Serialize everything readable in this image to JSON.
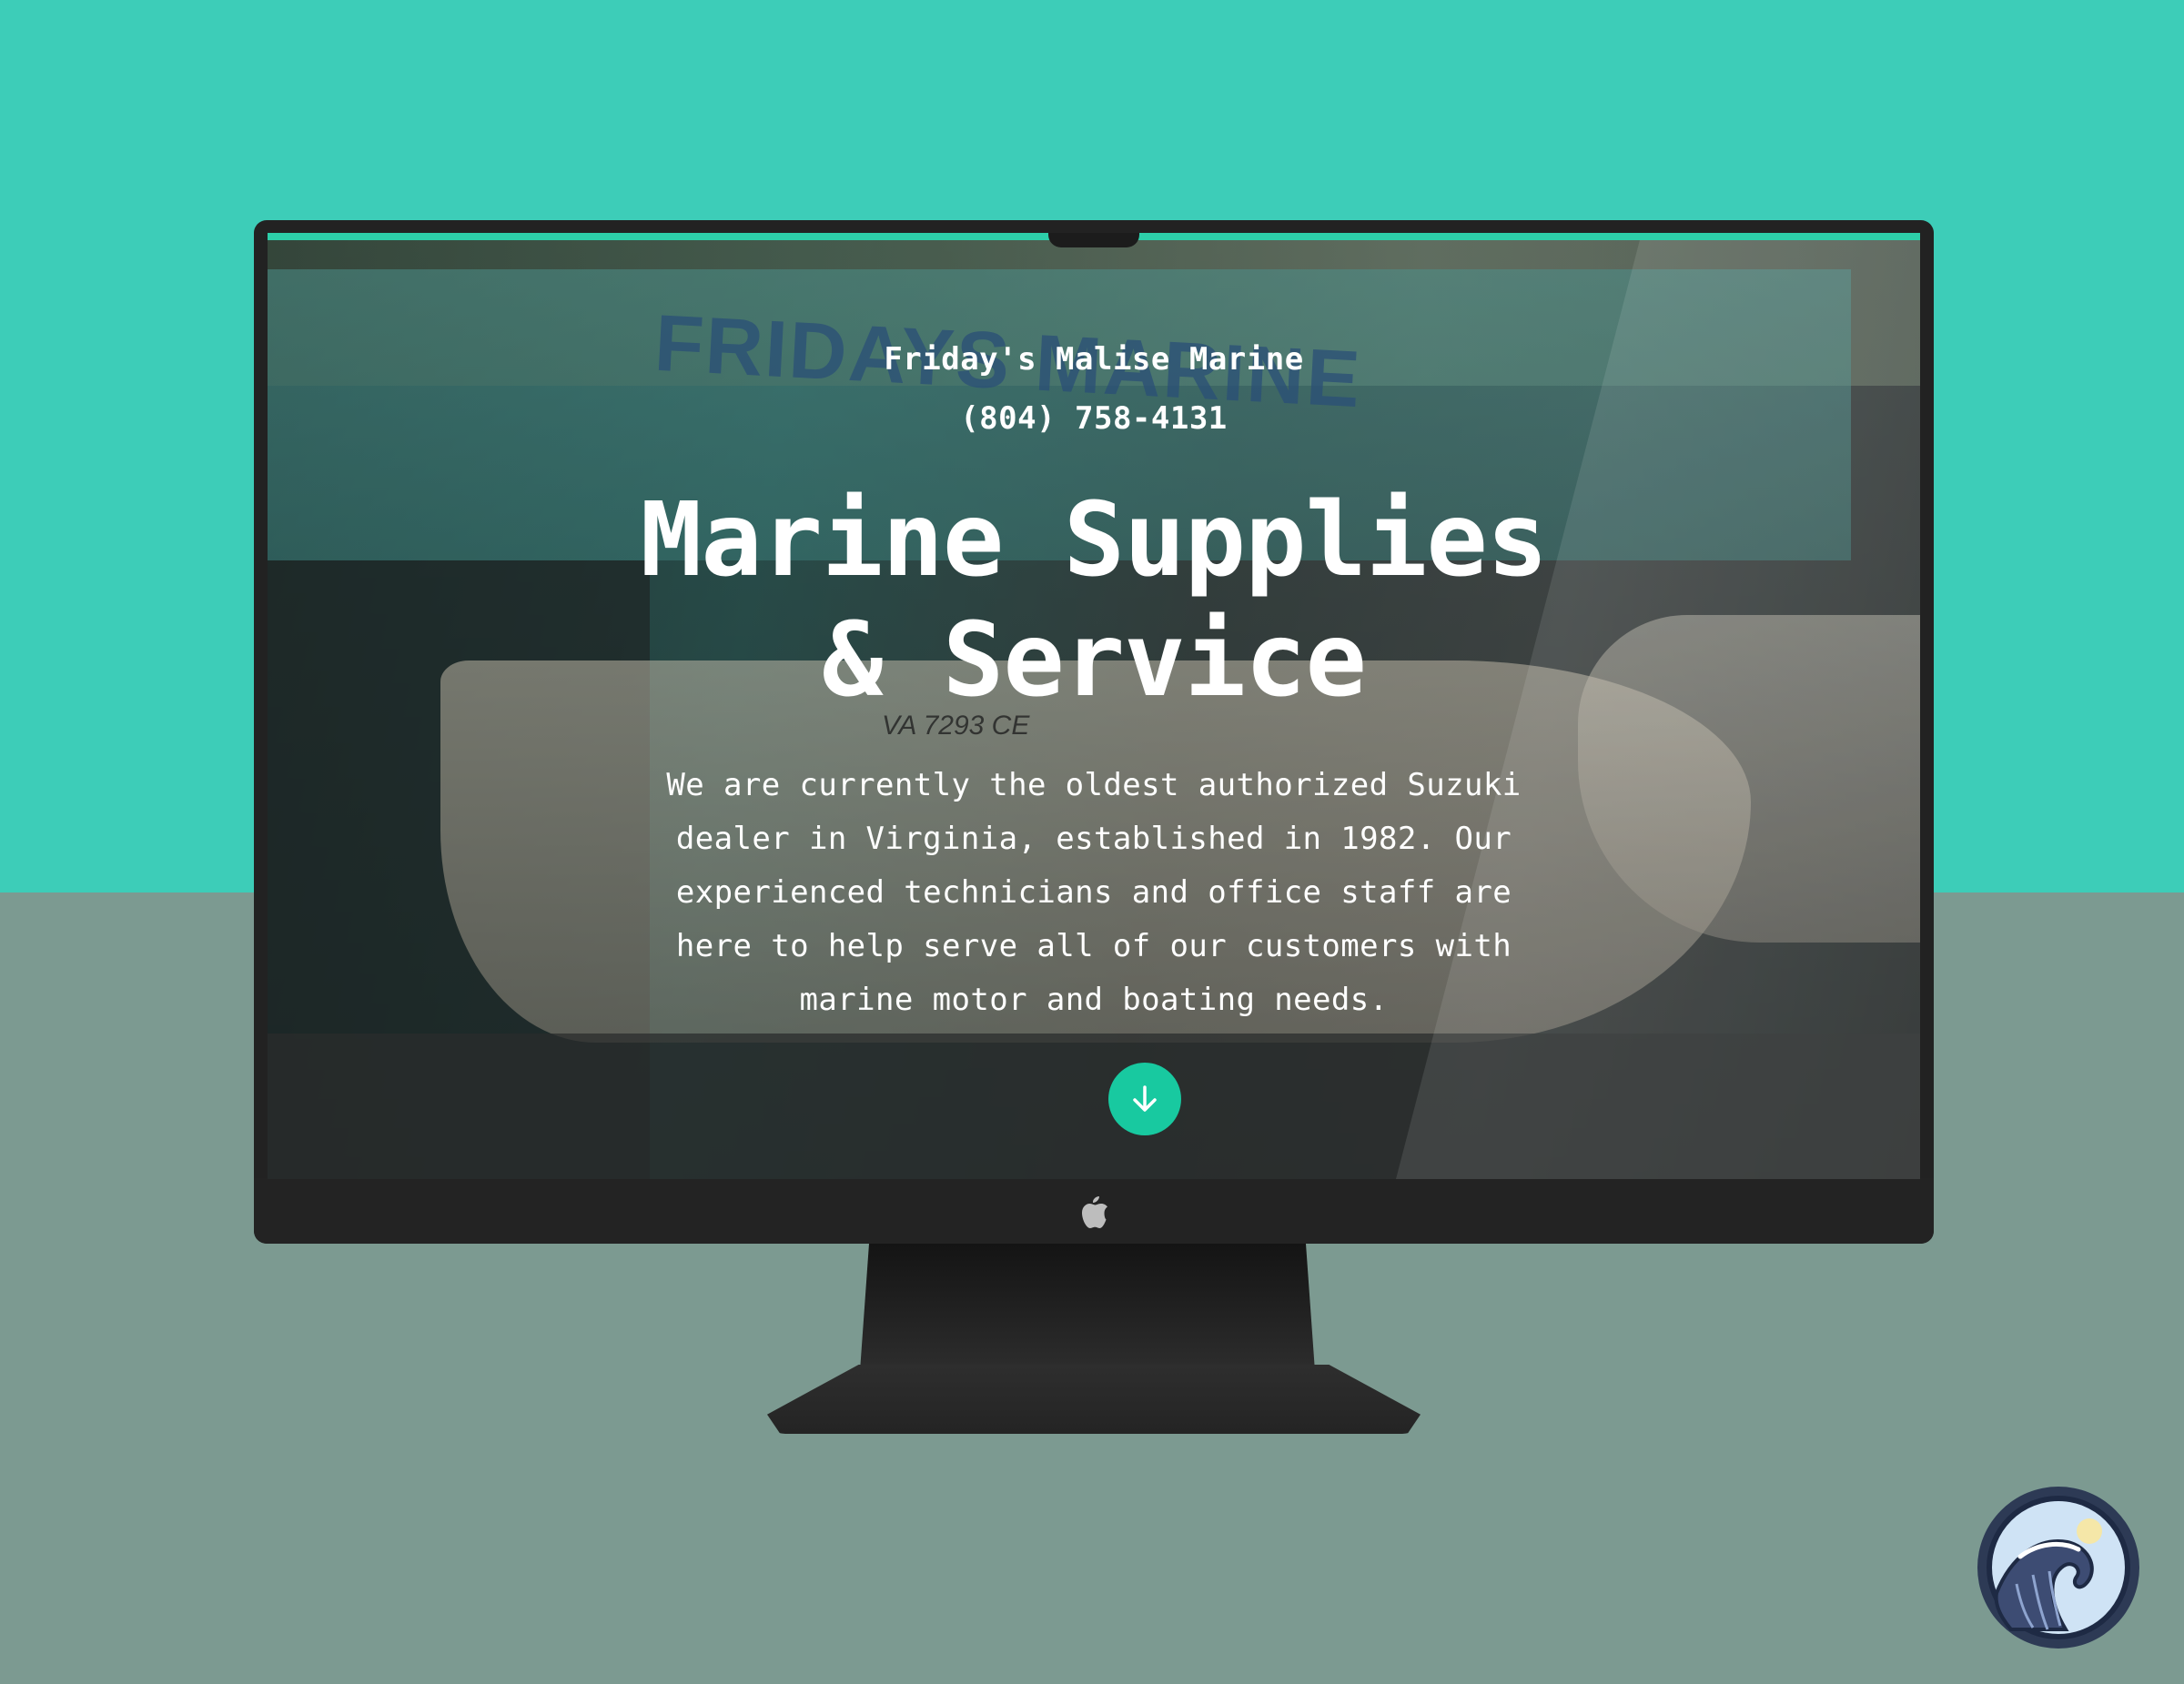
{
  "site": {
    "name": "Friday's Malise Marine",
    "phone": "(804) 758-4131"
  },
  "hero": {
    "title_line1": "Marine Supplies",
    "title_line2": "& Service",
    "description": "We are currently the oldest authorized Suzuki dealer in Virginia, established in 1982. Our experienced technicians and office staff are here to help serve all of our customers with marine motor and boating needs.",
    "photo_sign_text": "FRIDAYS MARINE",
    "photo_registration_text": "VA 7293 CE"
  },
  "icons": {
    "scroll_down": "arrow-down-icon",
    "monitor_logo": "apple-logo-icon",
    "badge": "wave-logo-icon"
  },
  "colors": {
    "background_top": "#3dcdb8",
    "background_bottom": "#7c9a91",
    "accent": "#18c9a0",
    "monitor_frame": "#222222"
  }
}
